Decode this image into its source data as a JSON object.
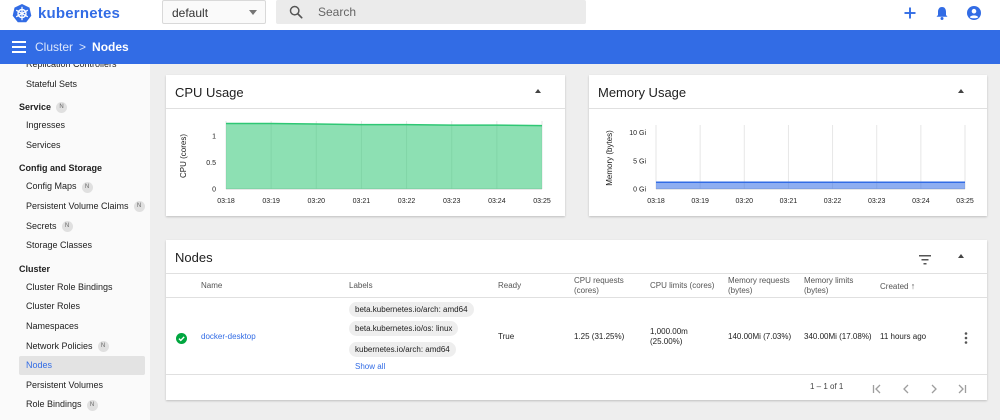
{
  "app": {
    "name": "kubernetes"
  },
  "namespace": {
    "selected": "default"
  },
  "search": {
    "placeholder": "Search"
  },
  "breadcrumb": {
    "parent": "Cluster",
    "separator": ">",
    "current": "Nodes"
  },
  "sidebar": {
    "items": [
      {
        "type": "item",
        "label": "Replication Controllers",
        "badge": ""
      },
      {
        "type": "item",
        "label": "Stateful Sets",
        "badge": ""
      },
      {
        "type": "header",
        "label": "Service",
        "badge": "N"
      },
      {
        "type": "item",
        "label": "Ingresses",
        "badge": ""
      },
      {
        "type": "item",
        "label": "Services",
        "badge": ""
      },
      {
        "type": "header",
        "label": "Config and Storage",
        "badge": ""
      },
      {
        "type": "item",
        "label": "Config Maps",
        "badge": "N"
      },
      {
        "type": "item",
        "label": "Persistent Volume Claims",
        "badge": "N"
      },
      {
        "type": "item",
        "label": "Secrets",
        "badge": "N"
      },
      {
        "type": "item",
        "label": "Storage Classes",
        "badge": ""
      },
      {
        "type": "header",
        "label": "Cluster",
        "badge": ""
      },
      {
        "type": "item",
        "label": "Cluster Role Bindings",
        "badge": ""
      },
      {
        "type": "item",
        "label": "Cluster Roles",
        "badge": ""
      },
      {
        "type": "item",
        "label": "Namespaces",
        "badge": ""
      },
      {
        "type": "item",
        "label": "Network Policies",
        "badge": "N"
      },
      {
        "type": "item",
        "label": "Nodes",
        "badge": "",
        "active": true
      },
      {
        "type": "item",
        "label": "Persistent Volumes",
        "badge": ""
      },
      {
        "type": "item",
        "label": "Role Bindings",
        "badge": "N"
      }
    ]
  },
  "cpu_card": {
    "title": "CPU Usage"
  },
  "memory_card": {
    "title": "Memory Usage"
  },
  "chart_data": [
    {
      "type": "area",
      "title": "CPU Usage",
      "ylabel": "CPU (cores)",
      "xlabel": "",
      "x": [
        "03:18",
        "03:19",
        "03:20",
        "03:21",
        "03:22",
        "03:23",
        "03:24",
        "03:25"
      ],
      "y_ticks": [
        "0",
        "0.5",
        "1"
      ],
      "ylim": [
        0,
        1.25
      ],
      "series": [
        {
          "values": [
            1.24,
            1.24,
            1.23,
            1.22,
            1.22,
            1.21,
            1.21,
            1.2
          ]
        }
      ],
      "color": "#2fc774",
      "grid": true
    },
    {
      "type": "area",
      "title": "Memory Usage",
      "ylabel": "Memory (bytes)",
      "xlabel": "",
      "x": [
        "03:18",
        "03:19",
        "03:20",
        "03:21",
        "03:22",
        "03:23",
        "03:24",
        "03:25"
      ],
      "y_ticks": [
        "0 Gi",
        "5 Gi",
        "10 Gi"
      ],
      "ylim": [
        0,
        11
      ],
      "series": [
        {
          "values": [
            1.2,
            1.2,
            1.2,
            1.2,
            1.2,
            1.2,
            1.2,
            1.2
          ]
        }
      ],
      "color": "#326ce5",
      "grid": true
    }
  ],
  "nodes_card": {
    "title": "Nodes",
    "columns": {
      "name": "Name",
      "labels": "Labels",
      "ready": "Ready",
      "cpu_requests": "CPU requests (cores)",
      "cpu_limits": "CPU limits (cores)",
      "memory_requests": "Memory requests (bytes)",
      "memory_limits": "Memory limits (bytes)",
      "created": "Created"
    },
    "rows": [
      {
        "name": "docker-desktop",
        "labels": [
          "beta.kubernetes.io/arch: amd64",
          "beta.kubernetes.io/os: linux",
          "kubernetes.io/arch: amd64"
        ],
        "show_all": "Show all",
        "ready": "True",
        "cpu_requests": "1.25 (31.25%)",
        "cpu_limits": "1,000.00m (25.00%)",
        "memory_requests": "140.00Mi (7.03%)",
        "memory_limits": "340.00Mi (17.08%)",
        "created": "11 hours ago"
      }
    ],
    "pagination": "1 – 1 of 1"
  },
  "colors": {
    "brand": "#326ce5",
    "cpu": "#2fc774",
    "ready": "#00a63f"
  }
}
